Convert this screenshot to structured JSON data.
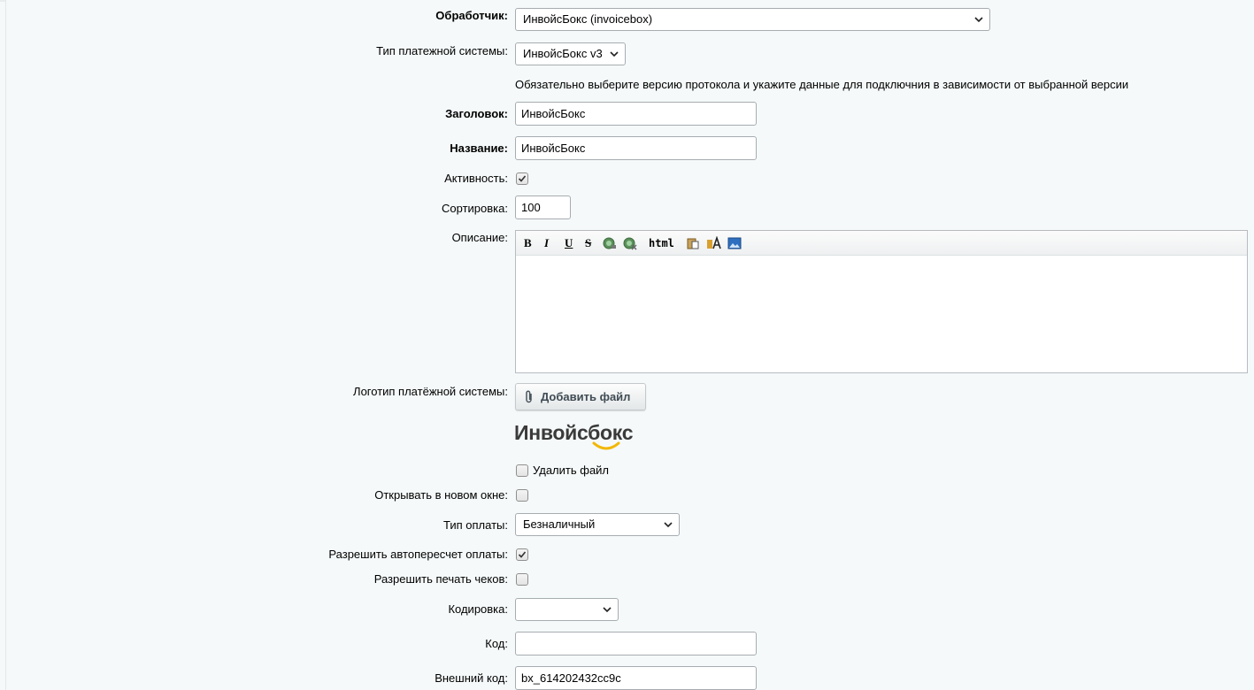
{
  "form": {
    "handler": {
      "label": "Обработчик:",
      "value": "ИнвойсБокс (invoicebox)"
    },
    "ps_type": {
      "label": "Тип платежной системы:",
      "value": "ИнвойсБокс v3"
    },
    "ps_hint": "Обязательно выберите версию протокола и укажите данные для подключния в зависимости от выбранной версии",
    "title": {
      "label": "Заголовок:",
      "value": "ИнвойсБокс"
    },
    "name": {
      "label": "Название:",
      "value": "ИнвойсБокс"
    },
    "active": {
      "label": "Активность:",
      "checked": true
    },
    "sort": {
      "label": "Сортировка:",
      "value": "100"
    },
    "description": {
      "label": "Описание:",
      "toolbar": [
        "B",
        "I",
        "U",
        "S",
        "link-icon",
        "unlink-icon",
        "html",
        "paste-icon",
        "font-icon",
        "image-icon"
      ],
      "html_label": "html"
    },
    "logo": {
      "label": "Логотип платёжной системы:",
      "add_file": "Добавить файл",
      "logo_text": "Инвойсбокс",
      "delete_file": "Удалить файл"
    },
    "new_window": {
      "label": "Открывать в новом окне:",
      "checked": false
    },
    "pay_type": {
      "label": "Тип оплаты:",
      "value": "Безналичный"
    },
    "auto_recalc": {
      "label": "Разрешить автопересчет оплаты:",
      "checked": true
    },
    "print_checks": {
      "label": "Разрешить печать чеков:",
      "checked": false
    },
    "encoding": {
      "label": "Кодировка:",
      "value": ""
    },
    "code": {
      "label": "Код:",
      "value": ""
    },
    "external_code": {
      "label": "Внешний код:",
      "value": "bx_614202432cc9c"
    }
  },
  "colors": {
    "logo_accent": "#f2b705",
    "border": "#a7acb1",
    "background": "#f5f9f9"
  }
}
